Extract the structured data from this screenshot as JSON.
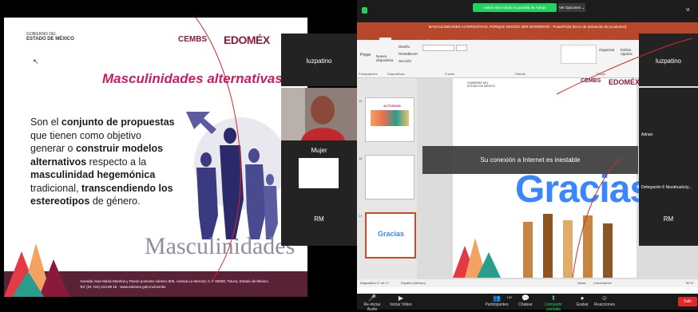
{
  "zoom_top": {
    "sharing_notice": "Usted está viendo la pantalla de Adrian",
    "view_options": "Ver Opciones ⌄",
    "view_button": "Vi"
  },
  "left_slide": {
    "gob_line1": "GOBIERNO DEL",
    "gob_line2": "ESTADO DE MÉXICO",
    "cembs": "CEMBS",
    "edomex": "EDOMÉX",
    "title": "Masculinidades alternativas",
    "body_1": "Son el ",
    "body_bold_1": "conjunto de propuestas",
    "body_2": " que tienen como objetivo generar o ",
    "body_bold_2": "construir modelos alternativos",
    "body_3": " respecto a la ",
    "body_bold_3": "masculinidad hegemónica",
    "body_4": " tradicional, ",
    "body_bold_4": "transcendiendo los estereotipos",
    "body_5": " de género.",
    "masc_word": "Masculinidades",
    "footer_1": "Avenida José María Morelos y Pavón poniente número 809, colonia La Merced, C.P. 50080, Toluca, Estado de México.",
    "footer_2": "Tel: (01 722) 213 89 15 · www.edomex.gob.mx/cembs"
  },
  "left_participants": [
    {
      "name": "luzpatino"
    },
    {
      "name": "Mujer"
    },
    {
      "name": "RM"
    }
  ],
  "ppt": {
    "title": "MASCULINIDADES ALTERNATIVAS, PORQUE DECIDO SER DIFERENTE - PowerPoint (Error de activación de productos)",
    "menu": [
      "Archivo",
      "Inicio",
      "Insertar",
      "Diseño",
      "Transiciones",
      "Animaciones",
      "Presentación con diapositivas",
      "Revisar",
      "Vista",
      "¿Qué desea hacer?"
    ],
    "ribbon_groups": [
      "Portapapeles",
      "Diapositivas",
      "Fuente",
      "Párrafo",
      "Dibujo"
    ],
    "ribbon_items": [
      "Pegar",
      "Nueva diapositiva",
      "Diseño",
      "Restablecer",
      "Sección",
      "Organizar",
      "Estilos rápidos"
    ],
    "thumb_numbers": [
      "15",
      "16",
      "17"
    ],
    "thumb_texts": [
      "ACTIVIDAD",
      "Gracias"
    ],
    "slide_gob": "GOBIERNO DEL ESTADO DE MÉXICO",
    "slide_cembs": "CEMBS",
    "slide_edomex": "EDOMÉX",
    "slide_word": "Gracias",
    "status_left": "Diapositiva 17 de 17",
    "status_lang": "Español (México)",
    "status_notes": "Notas",
    "status_comments": "Comentarios",
    "status_zoom": "50 %"
  },
  "right_participants": [
    {
      "name": "luzpatino"
    },
    {
      "name": "Adrian"
    },
    {
      "name": "Delegación 6 Nezahualcóy..."
    },
    {
      "name": "RM"
    }
  ],
  "banner": "Su conexión a Internet es inestable",
  "zoom_bar": {
    "items": [
      "Re-iniciar Audio",
      "Iniciar Video",
      "Participantes",
      "Chatear",
      "Compartir pantalla",
      "Grabar",
      "Reacciones"
    ],
    "participants_count": "100",
    "leave": "Salir"
  },
  "colors": {
    "ppt_red": "#b7472a",
    "zoom_green": "#23d160",
    "accent_pink": "#c81e67"
  }
}
